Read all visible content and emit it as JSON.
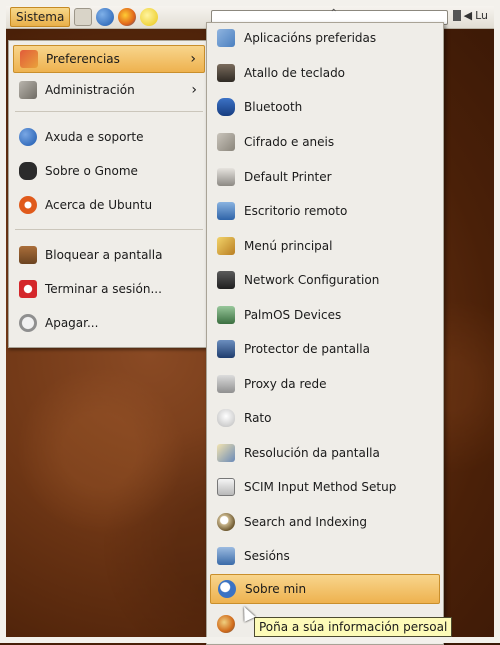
{
  "panel": {
    "sistema_label": "Sistema",
    "combo_arrow": "⌃",
    "tray_text": "Lu",
    "icons": [
      "home-icon",
      "help-icon",
      "firefox-icon",
      "notes-icon"
    ]
  },
  "main_menu": {
    "items": [
      {
        "label": "Preferencias",
        "icon": "preferences-icon",
        "submenu": true,
        "highlighted": true
      },
      {
        "label": "Administración",
        "icon": "administration-icon",
        "submenu": true
      },
      {
        "label": "Axuda e soporte",
        "icon": "help-icon"
      },
      {
        "label": "Sobre o Gnome",
        "icon": "gnome-foot-icon"
      },
      {
        "label": "Acerca de Ubuntu",
        "icon": "ubuntu-icon"
      },
      {
        "label": "Bloquear a pantalla",
        "icon": "lock-screen-icon"
      },
      {
        "label": "Terminar a sesión...",
        "icon": "logout-icon"
      },
      {
        "label": "Apagar...",
        "icon": "power-icon"
      }
    ],
    "submenu_arrow": "›"
  },
  "preferences_submenu": {
    "items": [
      {
        "label": "Aplicacións preferidas",
        "icon": "preferred-apps-icon"
      },
      {
        "label": "Atallo de teclado",
        "icon": "keyboard-icon"
      },
      {
        "label": "Bluetooth",
        "icon": "bluetooth-icon"
      },
      {
        "label": "Cifrado e aneis",
        "icon": "keyring-icon"
      },
      {
        "label": "Default Printer",
        "icon": "printer-icon"
      },
      {
        "label": "Escritorio remoto",
        "icon": "remote-desktop-icon"
      },
      {
        "label": "Menú principal",
        "icon": "menu-editor-icon"
      },
      {
        "label": "Network Configuration",
        "icon": "network-icon"
      },
      {
        "label": "PalmOS Devices",
        "icon": "palm-icon"
      },
      {
        "label": "Protector de pantalla",
        "icon": "screensaver-icon"
      },
      {
        "label": "Proxy da rede",
        "icon": "proxy-icon"
      },
      {
        "label": "Rato",
        "icon": "mouse-icon"
      },
      {
        "label": "Resolución da pantalla",
        "icon": "resolution-icon"
      },
      {
        "label": "SCIM Input Method Setup",
        "icon": "scim-icon"
      },
      {
        "label": "Search and Indexing",
        "icon": "search-icon"
      },
      {
        "label": "Sesións",
        "icon": "sessions-icon"
      },
      {
        "label": "Sobre min",
        "icon": "about-me-icon",
        "highlighted": true
      },
      {
        "label": "",
        "icon": "personal-info-icon"
      }
    ]
  },
  "tooltip": {
    "text": "Poña a súa información persoal"
  }
}
